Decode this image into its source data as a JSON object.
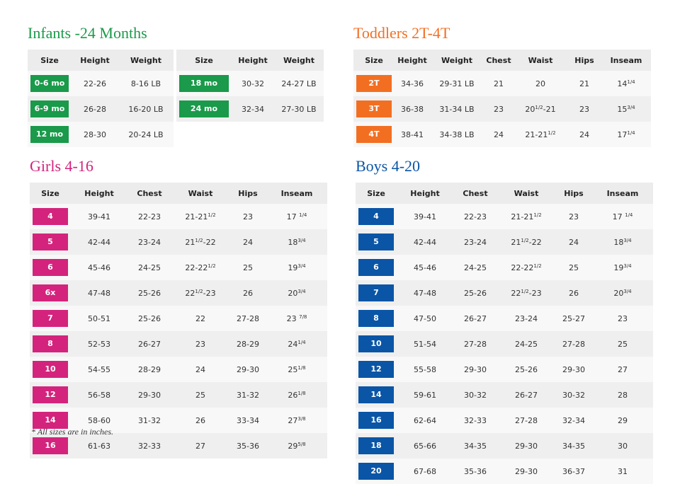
{
  "colors": {
    "infants": "#1a9a4a",
    "toddlers": "#f26f22",
    "girls": "#d4237c",
    "boys": "#0a55a6"
  },
  "infants": {
    "title": "Infants -24 Months",
    "tables": [
      {
        "headers": [
          "Size",
          "Height",
          "Weight"
        ],
        "rows": [
          [
            "0-6 mo",
            "22-26",
            "8-16 LB"
          ],
          [
            "6-9 mo",
            "26-28",
            "16-20 LB"
          ],
          [
            "12 mo",
            "28-30",
            "20-24 LB"
          ]
        ]
      },
      {
        "headers": [
          "Size",
          "Height",
          "Weight"
        ],
        "rows": [
          [
            "18 mo",
            "30-32",
            "24-27 LB"
          ],
          [
            "24 mo",
            "32-34",
            "27-30 LB"
          ]
        ]
      }
    ]
  },
  "toddlers": {
    "title": "Toddlers 2T-4T",
    "headers": [
      "Size",
      "Height",
      "Weight",
      "Chest",
      "Waist",
      "Hips",
      "Inseam"
    ],
    "rows": [
      [
        "2T",
        "34-36",
        "29-31 LB",
        "21",
        "20",
        "21",
        "14<sup>1/4</sup>"
      ],
      [
        "3T",
        "36-38",
        "31-34 LB",
        "23",
        "20<sup>1/2</sup>-21",
        "23",
        "15<sup>3/4</sup>"
      ],
      [
        "4T",
        "38-41",
        "34-38 LB",
        "24",
        "21-21<sup>1/2</sup>",
        "24",
        "17<sup>1/4</sup>"
      ]
    ]
  },
  "girls": {
    "title": "Girls 4-16",
    "headers": [
      "Size",
      "Height",
      "Chest",
      "Waist",
      "Hips",
      "Inseam"
    ],
    "rows": [
      [
        "4",
        "39-41",
        "22-23",
        "21-21<sup>1/2</sup>",
        "23",
        "17 <sup>1/4</sup>"
      ],
      [
        "5",
        "42-44",
        "23-24",
        "21<sup>1/2</sup>-22",
        "24",
        "18<sup>3/4</sup>"
      ],
      [
        "6",
        "45-46",
        "24-25",
        "22-22<sup>1/2</sup>",
        "25",
        "19<sup>3/4</sup>"
      ],
      [
        "6x",
        "47-48",
        "25-26",
        "22<sup>1/2</sup>-23",
        "26",
        "20<sup>3/4</sup>"
      ],
      [
        "7",
        "50-51",
        "25-26",
        "22",
        "27-28",
        "23 <sup>7/8</sup>"
      ],
      [
        "8",
        "52-53",
        "26-27",
        "23",
        "28-29",
        "24<sup>1/4</sup>"
      ],
      [
        "10",
        "54-55",
        "28-29",
        "24",
        "29-30",
        "25<sup>1/8</sup>"
      ],
      [
        "12",
        "56-58",
        "29-30",
        "25",
        "31-32",
        "26<sup>1/8</sup>"
      ],
      [
        "14",
        "58-60",
        "31-32",
        "26",
        "33-34",
        "27<sup>3/8</sup>"
      ],
      [
        "16",
        "61-63",
        "32-33",
        "27",
        "35-36",
        "29<sup>5/8</sup>"
      ]
    ],
    "footnote": "* All sizes are in inches."
  },
  "boys": {
    "title": "Boys 4-20",
    "headers": [
      "Size",
      "Height",
      "Chest",
      "Waist",
      "Hips",
      "Inseam"
    ],
    "rows": [
      [
        "4",
        "39-41",
        "22-23",
        "21-21<sup>1/2</sup>",
        "23",
        "17 <sup>1/4</sup>"
      ],
      [
        "5",
        "42-44",
        "23-24",
        "21<sup>1/2</sup>-22",
        "24",
        "18<sup>3/4</sup>"
      ],
      [
        "6",
        "45-46",
        "24-25",
        "22-22<sup>1/2</sup>",
        "25",
        "19<sup>3/4</sup>"
      ],
      [
        "7",
        "47-48",
        "25-26",
        "22<sup>1/2</sup>-23",
        "26",
        "20<sup>3/4</sup>"
      ],
      [
        "8",
        "47-50",
        "26-27",
        "23-24",
        "25-27",
        "23"
      ],
      [
        "10",
        "51-54",
        "27-28",
        "24-25",
        "27-28",
        "25"
      ],
      [
        "12",
        "55-58",
        "29-30",
        "25-26",
        "29-30",
        "27"
      ],
      [
        "14",
        "59-61",
        "30-32",
        "26-27",
        "30-32",
        "28"
      ],
      [
        "16",
        "62-64",
        "32-33",
        "27-28",
        "32-34",
        "29"
      ],
      [
        "18",
        "65-66",
        "34-35",
        "29-30",
        "34-35",
        "30"
      ],
      [
        "20",
        "67-68",
        "35-36",
        "29-30",
        "36-37",
        "31"
      ]
    ]
  }
}
